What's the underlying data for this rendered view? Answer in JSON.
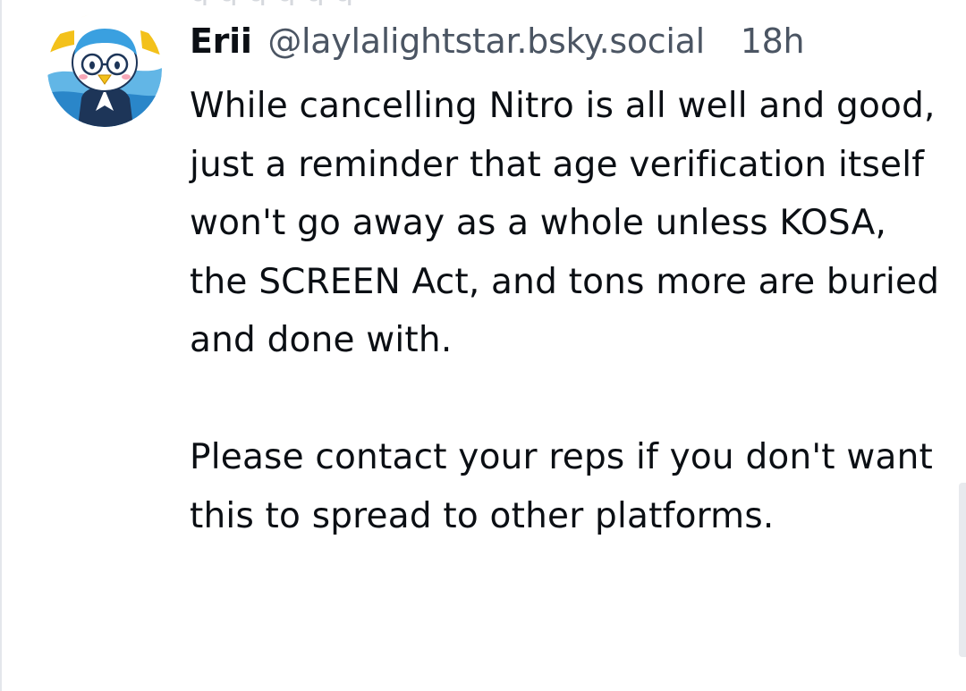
{
  "post": {
    "author": {
      "display_name": "Erii",
      "handle": "@laylalightstar.bsky.social",
      "avatar_icon": "penguin-character-avatar"
    },
    "timestamp": "18h",
    "body": {
      "paragraph_1": "While cancelling Nitro is all well and good, just a reminder that age verification itself won't go away as a whole unless KOSA, the SCREEN Act, and tons more are buried and done with.",
      "paragraph_2": "Please contact your reps if you don't want this to spread to other platforms."
    }
  },
  "colors": {
    "text_primary": "#0b0f14",
    "text_secondary": "#4b5563",
    "background": "#ffffff",
    "avatar_ring_yellow": "#f3c11b",
    "avatar_ring_blue": "#1f8fd6"
  }
}
